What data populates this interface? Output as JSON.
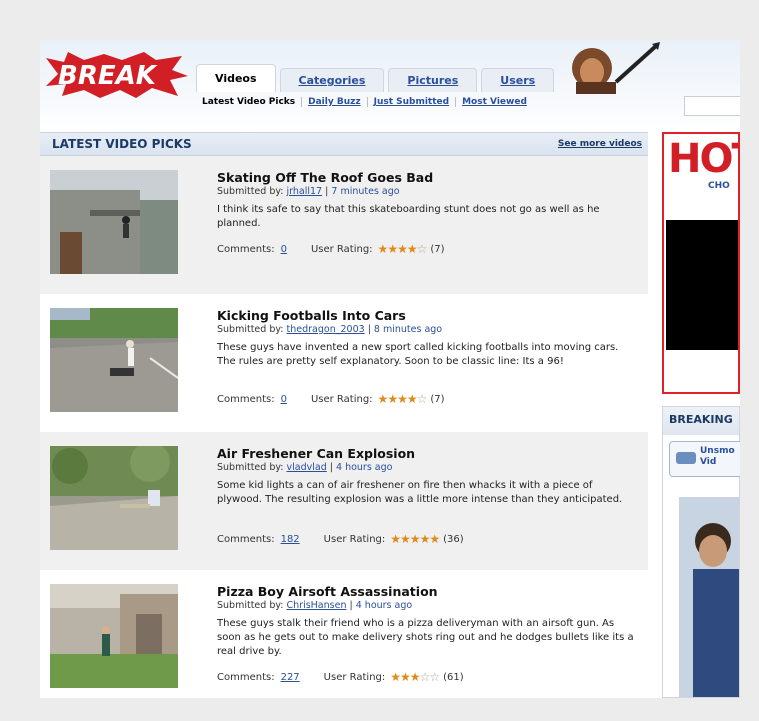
{
  "site": {
    "logo_text": "BREAK",
    "tabs": [
      {
        "label": "Videos",
        "active": true
      },
      {
        "label": "Categories",
        "active": false
      },
      {
        "label": "Pictures",
        "active": false
      },
      {
        "label": "Users",
        "active": false
      }
    ],
    "subnav": [
      {
        "label": "Latest Video Picks",
        "active": true
      },
      {
        "label": "Daily Buzz",
        "active": false
      },
      {
        "label": "Just Submitted",
        "active": false
      },
      {
        "label": "Most Viewed",
        "active": false
      }
    ]
  },
  "section": {
    "title": "LATEST VIDEO PICKS",
    "see_more": "See more videos"
  },
  "videos": [
    {
      "title": "Skating Off The Roof Goes Bad",
      "submitted_label": "Submitted by:",
      "user": "jrhall17",
      "time": "7 minutes ago",
      "description": "I think its safe to say that this skateboarding stunt does not go as well as he planned.",
      "comments_label": "Comments:",
      "comments": "0",
      "rating_label": "User Rating:",
      "rating": 4,
      "rating_count": "(7)"
    },
    {
      "title": "Kicking Footballs Into Cars",
      "submitted_label": "Submitted by:",
      "user": "thedragon_2003",
      "time": "8 minutes ago",
      "description": "These guys have invented a new sport called kicking footballs into moving cars. The rules are pretty self explanatory. Soon to be classic line: Its a 96!",
      "comments_label": "Comments:",
      "comments": "0",
      "rating_label": "User Rating:",
      "rating": 4,
      "rating_count": "(7)"
    },
    {
      "title": "Air Freshener Can Explosion",
      "submitted_label": "Submitted by:",
      "user": "vladvlad",
      "time": "4 hours ago",
      "description": "Some kid lights a can of air freshener on fire then whacks it with a piece of plywood. The resulting explosion was a little more intense than they anticipated.",
      "comments_label": "Comments:",
      "comments": "182",
      "rating_label": "User Rating:",
      "rating": 5,
      "rating_count": "(36)"
    },
    {
      "title": "Pizza Boy Airsoft Assassination",
      "submitted_label": "Submitted by:",
      "user": "ChrisHansen",
      "time": "4 hours ago",
      "description": "These guys stalk their friend who is a pizza deliveryman with an airsoft gun. As soon as he gets out to make delivery shots ring out and he dodges bullets like its a real drive by.",
      "comments_label": "Comments:",
      "comments": "227",
      "rating_label": "User Rating:",
      "rating": 3,
      "rating_count": "(61)"
    }
  ],
  "sidebar": {
    "ad_text": "HOT",
    "ad_sub": "CHO",
    "breaking_title": "BREAKING",
    "unsmo_line1": "Unsmo",
    "unsmo_line2": "Vid"
  },
  "colors": {
    "accent": "#2a4f9b",
    "brand_red": "#d21f26",
    "star": "#e08a1a"
  }
}
